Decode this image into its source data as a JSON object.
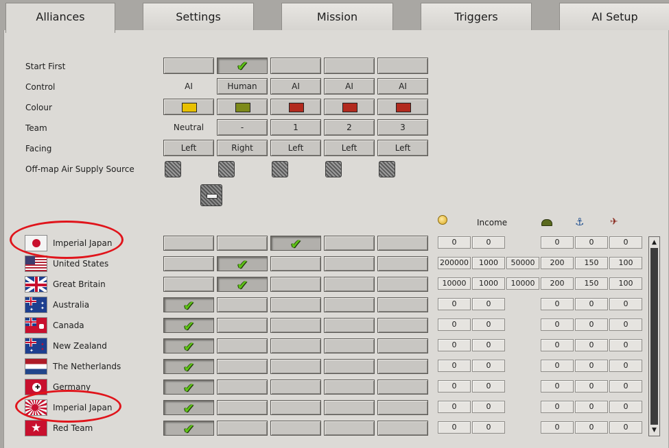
{
  "tabs": [
    {
      "label": "Alliances",
      "active": true
    },
    {
      "label": "Settings",
      "active": false
    },
    {
      "label": "Mission",
      "active": false
    },
    {
      "label": "Triggers",
      "active": false
    },
    {
      "label": "AI Setup",
      "active": false
    }
  ],
  "settings_rows": {
    "start_first": "Start First",
    "control": "Control",
    "colour": "Colour",
    "team": "Team",
    "facing": "Facing",
    "air_supply": "Off-map Air Supply Source"
  },
  "controls": [
    "AI",
    "Human",
    "AI",
    "AI",
    "AI"
  ],
  "colours": [
    "#e8c000",
    "#7d8a1a",
    "#b22a1e",
    "#b22a1e",
    "#b22a1e"
  ],
  "teams": [
    "Neutral",
    "-",
    "1",
    "2",
    "3"
  ],
  "facings": [
    "Left",
    "Right",
    "Left",
    "Left",
    "Left"
  ],
  "start_first_selected": 1,
  "resource_headers": {
    "income": "Income",
    "icons": [
      "gold-coin-icon",
      "helmet-icon",
      "anchor-icon",
      "plane-icon"
    ]
  },
  "nations": [
    {
      "name": "Imperial Japan",
      "flag": "japan",
      "team": 2,
      "values": [
        "0",
        "0",
        "",
        "0",
        "0",
        "0"
      ]
    },
    {
      "name": "United States",
      "flag": "usa",
      "team": 1,
      "values": [
        "200000",
        "1000",
        "50000",
        "200",
        "150",
        "100"
      ]
    },
    {
      "name": "Great Britain",
      "flag": "uk",
      "team": 1,
      "values": [
        "10000",
        "1000",
        "10000",
        "200",
        "150",
        "100"
      ]
    },
    {
      "name": "Australia",
      "flag": "australia",
      "team": 0,
      "values": [
        "0",
        "0",
        "",
        "0",
        "0",
        "0"
      ]
    },
    {
      "name": "Canada",
      "flag": "canada",
      "team": 0,
      "values": [
        "0",
        "0",
        "",
        "0",
        "0",
        "0"
      ]
    },
    {
      "name": "New Zealand",
      "flag": "newzealand",
      "team": 0,
      "values": [
        "0",
        "0",
        "",
        "0",
        "0",
        "0"
      ]
    },
    {
      "name": "The Netherlands",
      "flag": "netherlands",
      "team": 0,
      "values": [
        "0",
        "0",
        "",
        "0",
        "0",
        "0"
      ]
    },
    {
      "name": "Germany",
      "flag": "germany",
      "team": 0,
      "values": [
        "0",
        "0",
        "",
        "0",
        "0",
        "0"
      ]
    },
    {
      "name": "Imperial Japan",
      "flag": "japan_rising_sun",
      "team": 0,
      "values": [
        "0",
        "0",
        "",
        "0",
        "0",
        "0"
      ]
    },
    {
      "name": "Red Team",
      "flag": "redteam",
      "team": 0,
      "values": [
        "0",
        "0",
        "",
        "0",
        "0",
        "0"
      ]
    }
  ],
  "annotation_color": "#e0141b"
}
